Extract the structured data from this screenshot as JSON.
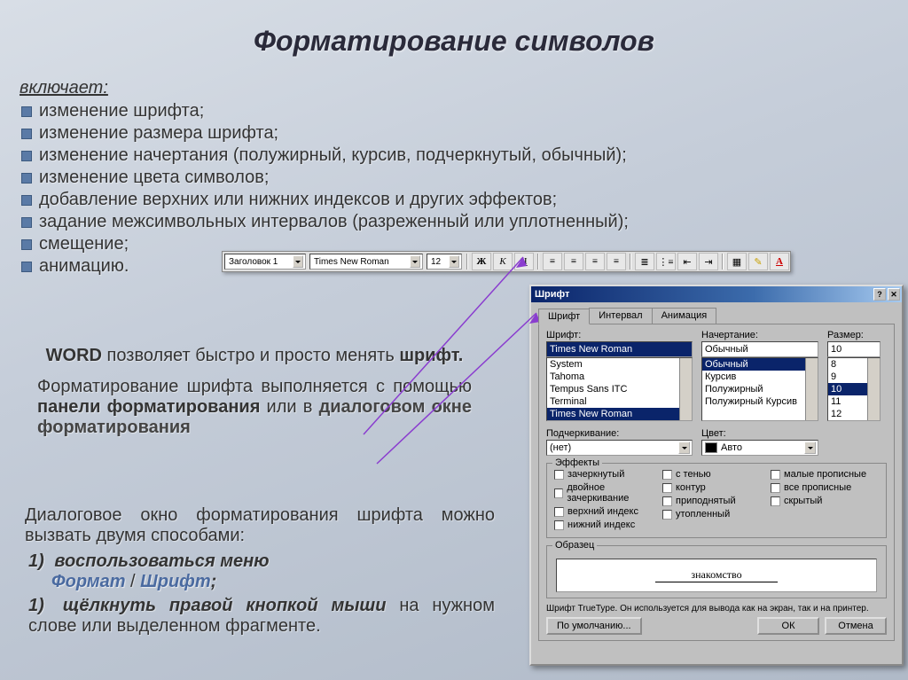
{
  "title": "Форматирование символов",
  "includes_label": "включает:",
  "bullets": [
    "изменение шрифта;",
    "изменение размера шрифта;",
    "изменение начертания (полужирный, курсив, подчеркнутый, обычный);",
    "изменение цвета символов;",
    "добавление верхних или нижних индексов и других эффектов;",
    "задание межсимвольных интервалов (разреженный или уплотненный);",
    "смещение;",
    "анимацию."
  ],
  "toolbar": {
    "style_combo": "Заголовок 1",
    "font_combo": "Times New Roman",
    "size_combo": "12",
    "bold": "Ж",
    "italic": "К",
    "underline": "Ч"
  },
  "desc": {
    "line1_pre": "WORD",
    "line1_rest": " позволяет быстро и просто менять ",
    "line1_b2": "шрифт.",
    "line2_pre": "Форматирование шрифта выполняется с помощью ",
    "line2_b1": "панели форматирования",
    "line2_mid": "     или в ",
    "line2_b2": "диалоговом окне форматирования"
  },
  "how": {
    "intro": "Диалоговое окно форматирования шрифта можно вызвать двумя способами:",
    "item1_num": "1)",
    "item1_a": "воспользоваться меню",
    "item1_m1": "Формат",
    "item1_sep": " / ",
    "item1_m2": "Шрифт",
    "item1_end": ";",
    "item2_num": "1)",
    "item2_a": "щёлкнуть правой кнопкой мыши",
    "item2_b": " на нужном слове или выделенном фрагменте."
  },
  "dialog": {
    "title": "Шрифт",
    "tabs": {
      "t1": "Шрифт",
      "t2": "Интервал",
      "t3": "Анимация"
    },
    "labels": {
      "font": "Шрифт:",
      "style": "Начертание:",
      "size": "Размер:",
      "underline": "Подчеркивание:",
      "color": "Цвет:",
      "effects": "Эффекты",
      "sample": "Образец"
    },
    "font_field": "Times New Roman",
    "font_list": [
      "System",
      "Tahoma",
      "Tempus Sans ITC",
      "Terminal",
      "Times New Roman"
    ],
    "style_field": "Обычный",
    "style_list": [
      "Обычный",
      "Курсив",
      "Полужирный",
      "Полужирный Курсив"
    ],
    "size_field": "10",
    "size_list": [
      "8",
      "9",
      "10",
      "11",
      "12"
    ],
    "underline_value": "(нет)",
    "color_value": "Авто",
    "effects": {
      "strike": "зачеркнутый",
      "dstrike": "двойное зачеркивание",
      "super": "верхний индекс",
      "sub": "нижний индекс",
      "shadow": "с тенью",
      "outline": "контур",
      "emboss": "приподнятый",
      "engrave": "утопленный",
      "smallcaps": "малые прописные",
      "allcaps": "все прописные",
      "hidden": "скрытый"
    },
    "sample_text": "знакомство",
    "hint": "Шрифт TrueType. Он используется для вывода как на экран, так и на принтер.",
    "buttons": {
      "default": "По умолчанию...",
      "ok": "ОК",
      "cancel": "Отмена"
    }
  }
}
